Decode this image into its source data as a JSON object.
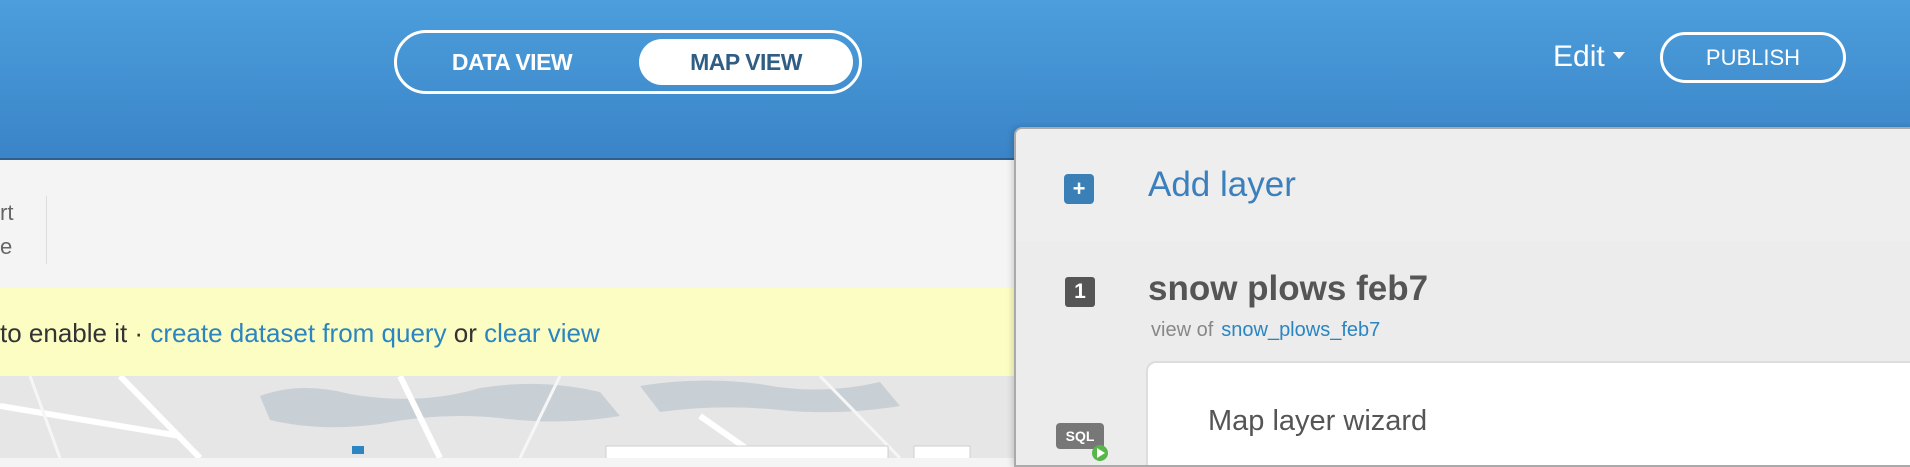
{
  "header": {
    "toggle": {
      "data_view": "DATA VIEW",
      "map_view": "MAP VIEW",
      "active": "map_view"
    },
    "edit": "Edit",
    "publish": "PUBLISH"
  },
  "toolbar": {
    "text_line1": "rt",
    "text_line2": "e"
  },
  "notice": {
    "prefix": "to enable it · ",
    "link_create": "create dataset from query",
    "middle": " or ",
    "link_clear": "clear view"
  },
  "layers_panel": {
    "add_layer": "Add layer",
    "layer": {
      "number": "1",
      "title": "snow plows feb7",
      "view_of": "view of",
      "source": "snow_plows_feb7"
    },
    "wizard": "Map layer wizard",
    "sql_icon_text": "SQL"
  },
  "colors": {
    "header": "#3a84c7",
    "link": "#2a85c2",
    "notice_bg": "#fcfdc3",
    "add_icon": "#3a7fb6"
  }
}
